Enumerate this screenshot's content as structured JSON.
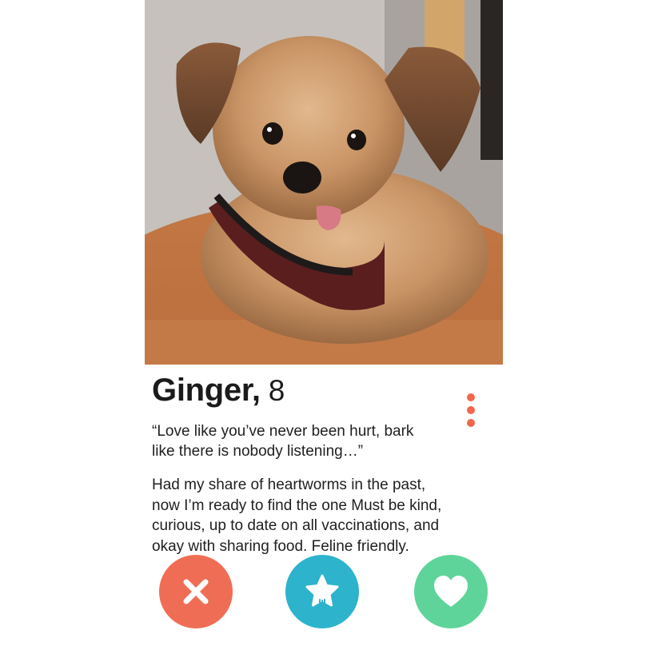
{
  "profile": {
    "name": "Ginger,",
    "age": "8",
    "quote": "“Love like you’ve never been hurt, bark\nlike  there is nobody listening…”",
    "bio": "Had my share of heartworms in the past,\nnow I’m ready to find the one Must be kind,\ncurious, up to date on all vaccinations, and\nokay with sharing food. Feline friendly."
  },
  "photo": {
    "subject": "small long-haired dog wearing a dark red harness, lying on an orange fluffy bed"
  },
  "actions": {
    "nope": {
      "icon": "close-icon",
      "color": "#f06d55"
    },
    "super": {
      "icon": "star-icon",
      "color": "#2eb3cc"
    },
    "like": {
      "icon": "heart-icon",
      "color": "#5ed49a"
    }
  },
  "menu": {
    "icon": "more-vertical-icon",
    "color": "#f2674b"
  }
}
